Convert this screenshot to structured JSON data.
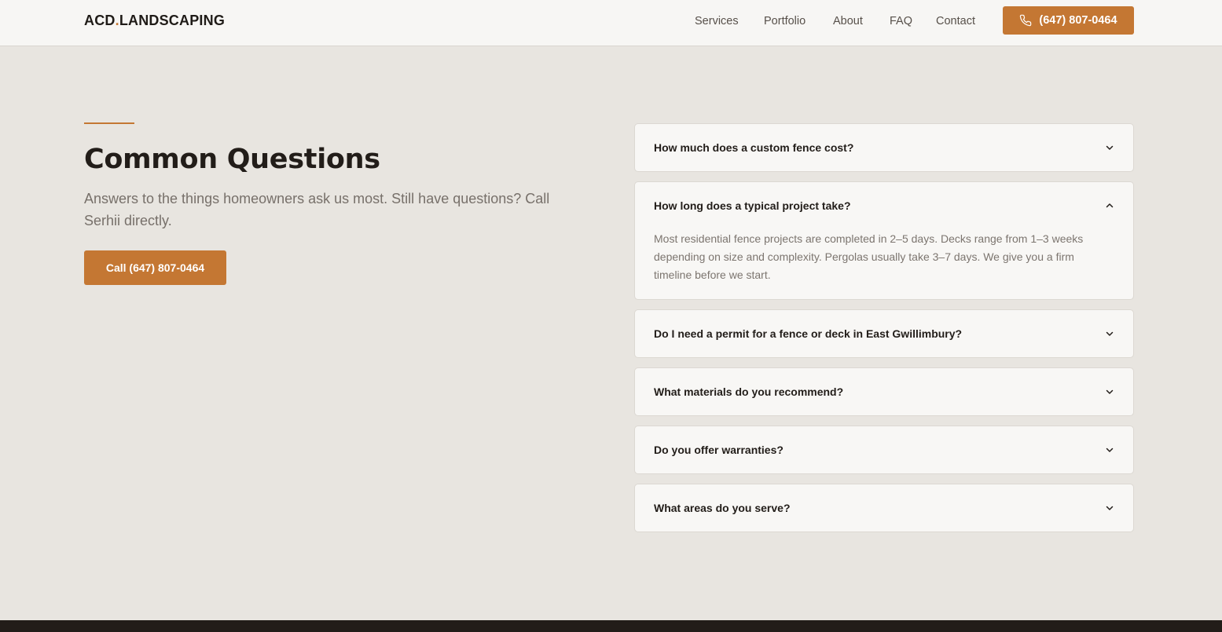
{
  "brand": {
    "name_part1": "ACD",
    "dot": ".",
    "name_part2": "LANDSCAPING",
    "accent_color": "#c47733"
  },
  "nav": {
    "items": [
      {
        "label": "Services"
      },
      {
        "label": "Portfolio"
      },
      {
        "label": "About"
      },
      {
        "label": "FAQ"
      },
      {
        "label": "Contact"
      }
    ],
    "phone_label": "(647) 807-0464",
    "phone_icon": "phone-icon"
  },
  "section": {
    "title": "Common Questions",
    "subtitle": "Answers to the things homeowners ask us most. Still have questions? Call Serhii directly.",
    "cta_label": "Call (647) 807-0464"
  },
  "faq": {
    "items": [
      {
        "question": "How much does a custom fence cost?",
        "expanded": false
      },
      {
        "question": "How long does a typical project take?",
        "expanded": true,
        "answer": "Most residential fence projects are completed in 2–5 days. Decks range from 1–3 weeks depending on size and complexity. Pergolas usually take 3–7 days. We give you a firm timeline before we start."
      },
      {
        "question": "Do I need a permit for a fence or deck in East Gwillimbury?",
        "expanded": false
      },
      {
        "question": "What materials do you recommend?",
        "expanded": false
      },
      {
        "question": "Do you offer warranties?",
        "expanded": false
      },
      {
        "question": "What areas do you serve?",
        "expanded": false
      }
    ]
  }
}
